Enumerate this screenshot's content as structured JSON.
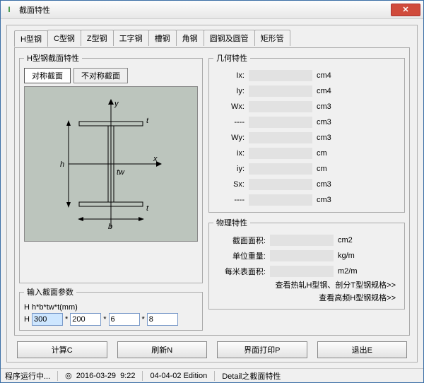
{
  "window": {
    "title": "截面特性"
  },
  "tabs": [
    "H型钢",
    "C型钢",
    "Z型钢",
    "工字钢",
    "槽钢",
    "角钢",
    "圆钢及圆管",
    "矩形管"
  ],
  "section": {
    "group_label": "H型钢截面特性",
    "sym_btn": "对称截面",
    "asym_btn": "不对称截面"
  },
  "param": {
    "group_label": "输入截面参数",
    "formula": "H   h*b*tw*t(mm)",
    "prefix": "H",
    "v0": "300",
    "v1": "200",
    "v2": "6",
    "v3": "8"
  },
  "geo": {
    "group_label": "几何特性",
    "rows": [
      {
        "lbl": "Ix:",
        "unit": "cm4"
      },
      {
        "lbl": "Iy:",
        "unit": "cm4"
      },
      {
        "lbl": "Wx:",
        "unit": "cm3"
      },
      {
        "lbl": "----",
        "unit": "cm3"
      },
      {
        "lbl": "Wy:",
        "unit": "cm3"
      },
      {
        "lbl": "ix:",
        "unit": "cm"
      },
      {
        "lbl": "iy:",
        "unit": "cm"
      },
      {
        "lbl": "Sx:",
        "unit": "cm3"
      },
      {
        "lbl": "----",
        "unit": "cm3"
      }
    ]
  },
  "phys": {
    "group_label": "物理特性",
    "rows": [
      {
        "lbl": "截面面积:",
        "unit": "cm2"
      },
      {
        "lbl": "单位重量:",
        "unit": "kg/m"
      },
      {
        "lbl": "每米表面积:",
        "unit": "m2/m"
      }
    ],
    "link1": "查看热轧H型钢、剖分T型钢规格>>",
    "link2": "查看高频H型钢规格>>"
  },
  "buttons": {
    "calc": "计算C",
    "refresh": "刷新N",
    "print": "界面打印P",
    "exit": "退出E"
  },
  "status": {
    "running": "程序运行中...",
    "date": "2016-03-29",
    "time": "9:22",
    "edition": "04-04-02 Edition",
    "detail": "Detail之截面特性"
  },
  "diagram": {
    "x": "x",
    "y": "y",
    "h": "h",
    "b": "b",
    "tw": "tw",
    "t1": "t",
    "t2": "t"
  }
}
